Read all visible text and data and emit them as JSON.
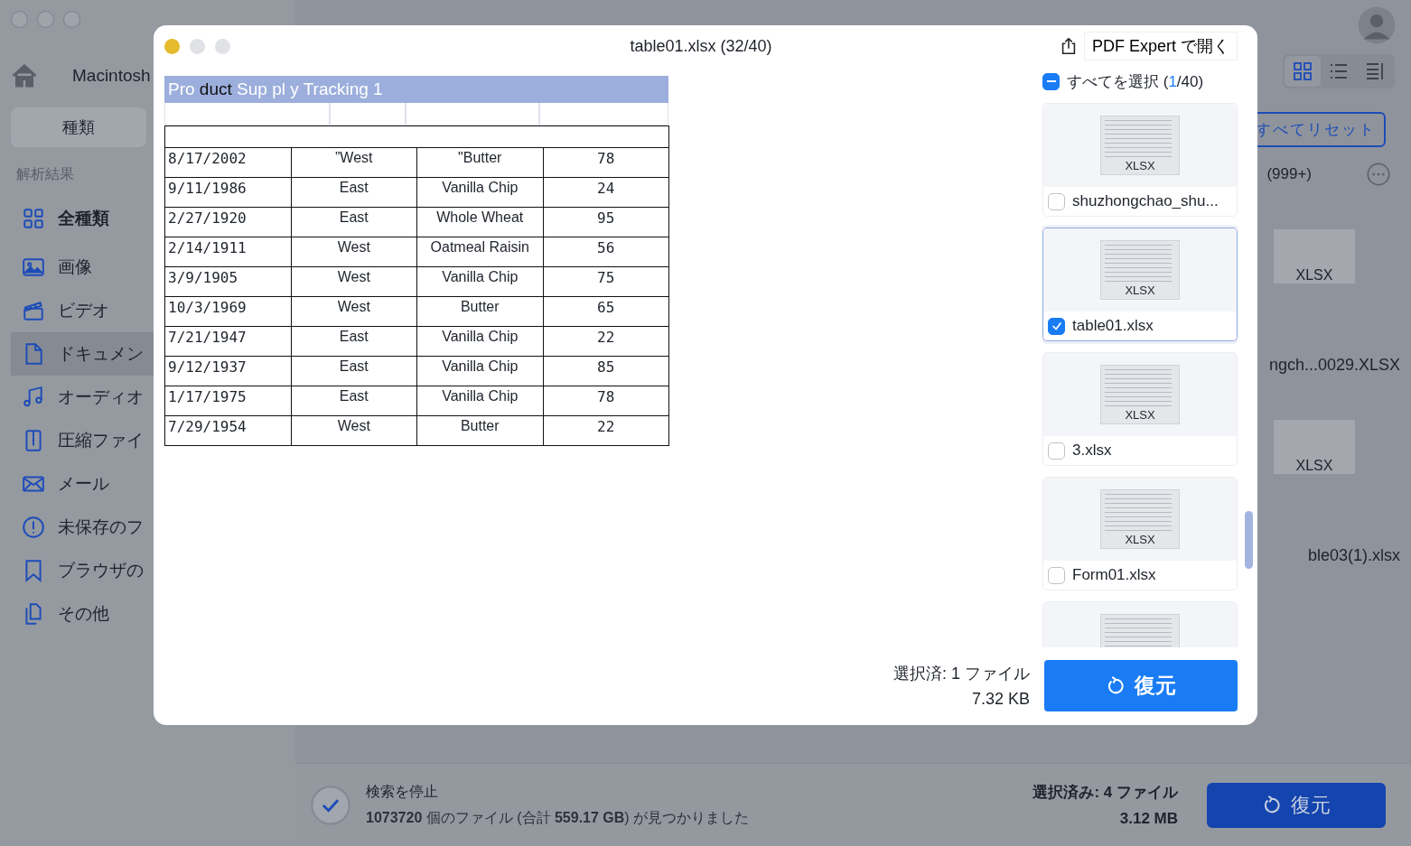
{
  "app": {
    "sidebar": {
      "location": "Macintosh",
      "tab": "種類",
      "section": "解析結果",
      "items": [
        {
          "label": "全種類",
          "kind": "summary",
          "selected": false
        },
        {
          "label": "画像",
          "kind": "category",
          "selected": false
        },
        {
          "label": "ビデオ",
          "kind": "category",
          "selected": false
        },
        {
          "label": "ドキュメン",
          "kind": "category",
          "selected": true
        },
        {
          "label": "オーディオ",
          "kind": "category",
          "selected": false
        },
        {
          "label": "圧縮ファイ",
          "kind": "category",
          "selected": false
        },
        {
          "label": "メール",
          "kind": "category",
          "selected": false
        },
        {
          "label": "未保存のフ",
          "kind": "category",
          "selected": false
        },
        {
          "label": "ブラウザの",
          "kind": "category",
          "selected": false
        },
        {
          "label": "その他",
          "kind": "category",
          "selected": false
        }
      ]
    },
    "views": [
      {
        "selected": true
      },
      {
        "selected": false
      },
      {
        "selected": false
      }
    ],
    "reset_button": "すべてリセット",
    "count": "(999+)",
    "files": [
      {
        "name": "ngch...0029.XLSX",
        "thumb_label": "XLSX"
      },
      {
        "name": "ble03(1).xlsx",
        "thumb_label": "XLSX"
      }
    ],
    "status": {
      "title": "検索を停止",
      "summary": "**1073720** 個のファイル (合計 **559.17 GB**) が見つかりました",
      "selected": "選択済み: 4 ファイル",
      "size": "3.12 MB",
      "restore": "復元"
    }
  },
  "preview": {
    "title": "table01.xlsx (32/40)",
    "open_with": "PDF Expert で開く",
    "select_all": {
      "before": "すべてを選択 (",
      "count": "1",
      "after": "/40)",
      "mixed": true
    },
    "sheet": {
      "title_parts": [
        {
          "text": "Pro ",
          "dark": false
        },
        {
          "text": "duct",
          "dark": true
        },
        {
          "text": " Sup pl y Tracking 1",
          "dark": false
        }
      ],
      "rows": [
        [
          "8/17/2002",
          "”West",
          "\"Butter",
          "78"
        ],
        [
          "9/11/1986",
          "East",
          "Vanilla Chip",
          "24"
        ],
        [
          "2/27/1920",
          "East",
          "Whole Wheat",
          "95"
        ],
        [
          "2/14/1911",
          "West",
          "Oatmeal Raisin",
          "56"
        ],
        [
          "3/9/1905",
          "West",
          "Vanilla Chip",
          "75"
        ],
        [
          "10/3/1969",
          "West",
          "Butter",
          "65"
        ],
        [
          "7/21/1947",
          "East",
          "Vanilla Chip",
          "22"
        ],
        [
          "9/12/1937",
          "East",
          "Vanilla Chip",
          "85"
        ],
        [
          "1/17/1975",
          "East",
          "Vanilla Chip",
          "78"
        ],
        [
          "7/29/1954",
          "West",
          "Butter",
          "22"
        ]
      ]
    },
    "files": [
      {
        "name": "shuzhongchao_shu...",
        "thumb_label": "XLSX",
        "checked": false,
        "selected": false
      },
      {
        "name": "table01.xlsx",
        "thumb_label": "XLSX",
        "checked": true,
        "selected": true
      },
      {
        "name": "3.xlsx",
        "thumb_label": "XLSX",
        "checked": false,
        "selected": false
      },
      {
        "name": "Form01.xlsx",
        "thumb_label": "XLSX",
        "checked": false,
        "selected": false
      },
      {
        "selected": false
      }
    ],
    "selection": "選択済: 1 ファイル",
    "size": "7.32 KB",
    "restore": "復元"
  }
}
